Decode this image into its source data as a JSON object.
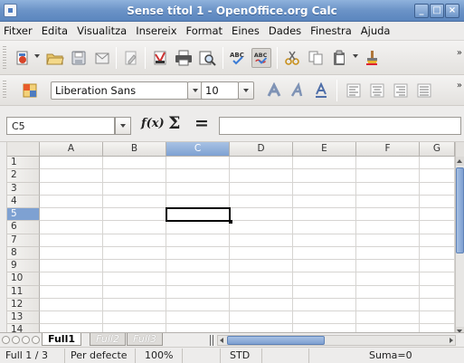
{
  "window": {
    "title": "Sense títol 1 - OpenOffice.org Calc"
  },
  "menu": [
    "Fitxer",
    "Edita",
    "Visualitza",
    "Insereix",
    "Format",
    "Eines",
    "Dades",
    "Finestra",
    "Ajuda"
  ],
  "formatting": {
    "font_name": "Liberation Sans",
    "font_size": "10"
  },
  "formula_bar": {
    "name_box": "C5",
    "formula": ""
  },
  "grid": {
    "columns": [
      "A",
      "B",
      "C",
      "D",
      "E",
      "F",
      "G"
    ],
    "rows": [
      "1",
      "2",
      "3",
      "4",
      "5",
      "6",
      "7",
      "8",
      "9",
      "10",
      "11",
      "12",
      "13",
      "14"
    ],
    "selected_column": "C",
    "selected_row": "5"
  },
  "sheets": {
    "tabs": [
      "Full1",
      "Full2",
      "Full3"
    ],
    "active": "Full1"
  },
  "status": {
    "sheet": "Full 1 / 3",
    "style": "Per defecte",
    "zoom": "100%",
    "mode": "STD",
    "sum": "Suma=0"
  },
  "colors": {
    "title_bar": "#6b93c7",
    "selection": "#7ea1d2"
  },
  "icons": {
    "toolbar1": [
      "new-document-icon",
      "open-icon",
      "save-icon",
      "email-icon",
      "edit-file-icon",
      "export-pdf-icon",
      "print-icon",
      "page-preview-icon",
      "spellcheck-icon",
      "autospellcheck-icon",
      "cut-icon",
      "copy-icon",
      "paste-icon",
      "format-paintbrush-icon"
    ],
    "toolbar2": [
      "styles-icon",
      "bold-icon",
      "italic-icon",
      "underline-icon",
      "align-left-icon",
      "align-center-icon",
      "align-right-icon",
      "justify-icon"
    ]
  }
}
